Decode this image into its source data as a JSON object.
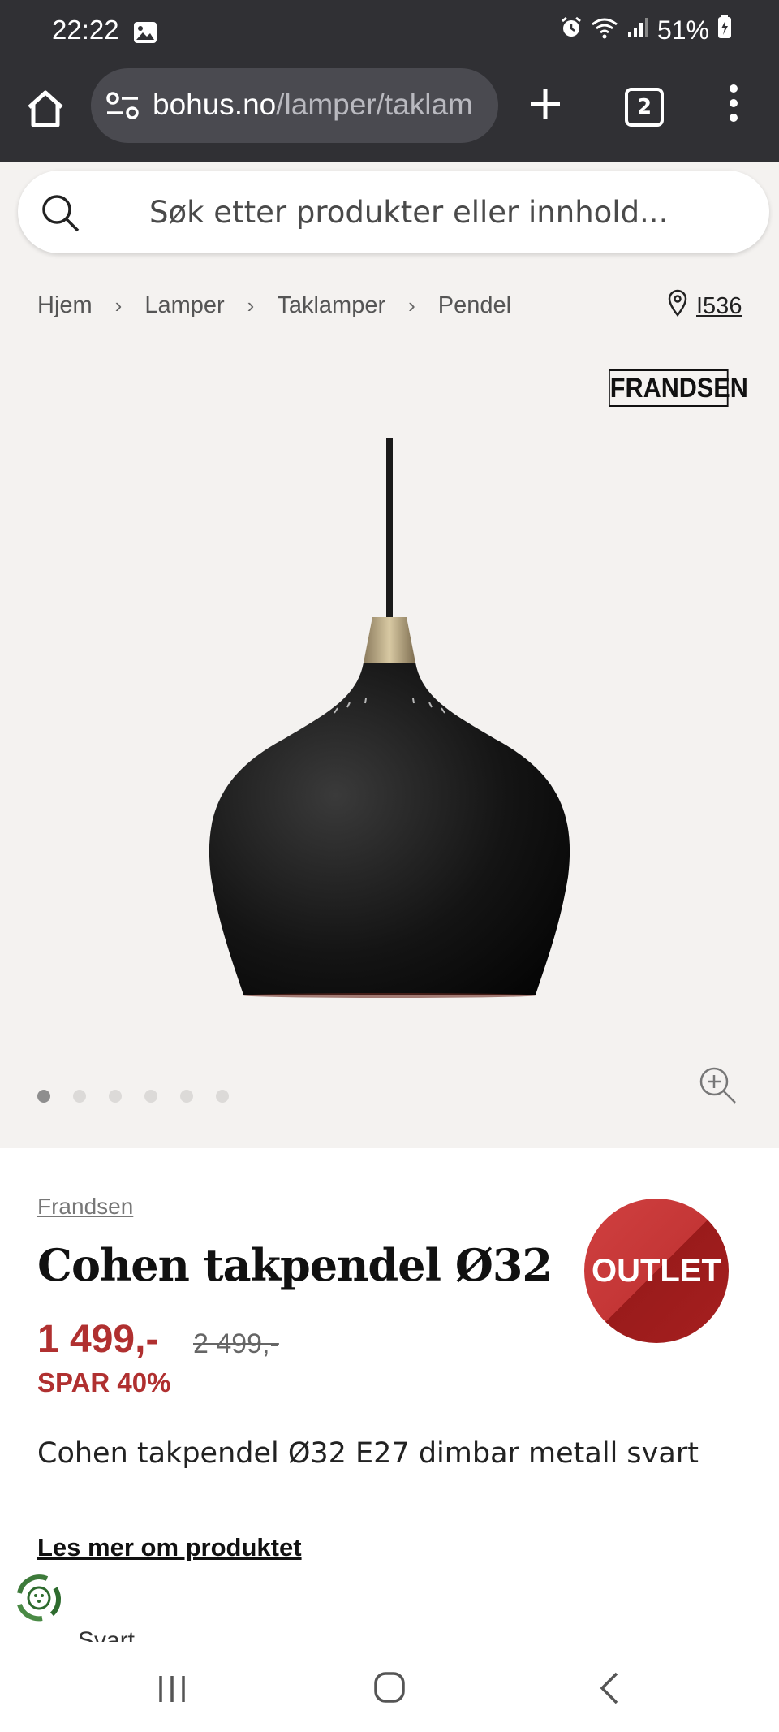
{
  "status_bar": {
    "time": "22:22",
    "battery": "51%",
    "icons": [
      "image-icon",
      "alarm-icon",
      "wifi-icon",
      "signal-icon",
      "battery-charging-icon"
    ]
  },
  "browser": {
    "url_host": "bohus.no",
    "url_path": "/lamper/taklam",
    "tab_count": "2",
    "icons": [
      "home-icon",
      "site-settings-icon",
      "plus-icon",
      "tabs-icon",
      "more-vert-icon"
    ]
  },
  "search": {
    "placeholder": "Søk etter produkter eller innhold..."
  },
  "breadcrumb": {
    "items": [
      "Hjem",
      "Lamper",
      "Taklamper",
      "Pendel"
    ],
    "separator": "›"
  },
  "store": {
    "label": "I536"
  },
  "gallery": {
    "brand_logo": "FRANDSEN",
    "image_count": 6,
    "active_index": 0
  },
  "product": {
    "brand": "Frandsen",
    "title": "Cohen takpendel Ø32",
    "badge": "OUTLET",
    "price": "1 499,-",
    "old_price": "2 499,-",
    "save": "SPAR 40%",
    "description": "Cohen takpendel Ø32 E27 dimbar metall svart",
    "read_more": "Les mer om produktet",
    "partial_text": "Svart"
  },
  "colors": {
    "accent_red": "#b03030",
    "toolbar_bg": "#303034",
    "page_bg": "#f4f2f0"
  }
}
